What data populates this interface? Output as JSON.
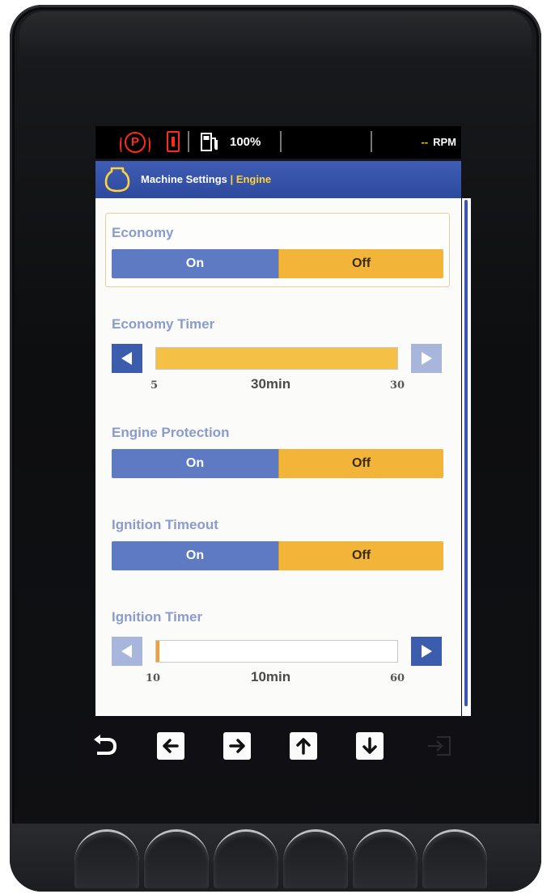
{
  "status": {
    "indicators": [
      "parking-brake-icon",
      "battery-warning-icon",
      "fuel-icon"
    ],
    "fuel_level": "100%",
    "rpm_value": "--",
    "rpm_unit": "RPM",
    "colors": {
      "warning": "#ff2a1a",
      "rpm_dash": "#ffcc00"
    }
  },
  "title": {
    "icon": "engine-icon",
    "main": "Machine Settings",
    "separator": "|",
    "sub": "Engine"
  },
  "settings": {
    "economy": {
      "label": "Economy",
      "on": "On",
      "off": "Off",
      "selected": "Off"
    },
    "economy_timer": {
      "label": "Economy Timer",
      "min": "5",
      "max": "30",
      "value": "30min",
      "fraction": 1.0
    },
    "engine_protection": {
      "label": "Engine Protection",
      "on": "On",
      "off": "Off",
      "selected": "Off"
    },
    "ignition_timeout": {
      "label": "Ignition Timeout",
      "on": "On",
      "off": "Off",
      "selected": "Off"
    },
    "ignition_timer": {
      "label": "Ignition Timer",
      "min": "10",
      "max": "60",
      "value": "10min",
      "fraction": 0.0
    }
  },
  "nav": [
    "back-icon",
    "arrow-left-icon",
    "arrow-right-icon",
    "arrow-up-icon",
    "arrow-down-icon",
    "enter-icon"
  ],
  "colors": {
    "title_bar": "#2d4a9e",
    "toggle_on": "#5d7ac3",
    "toggle_off": "#f3b43a",
    "label": "#8a9bd0",
    "accent": "#ffd23c"
  }
}
